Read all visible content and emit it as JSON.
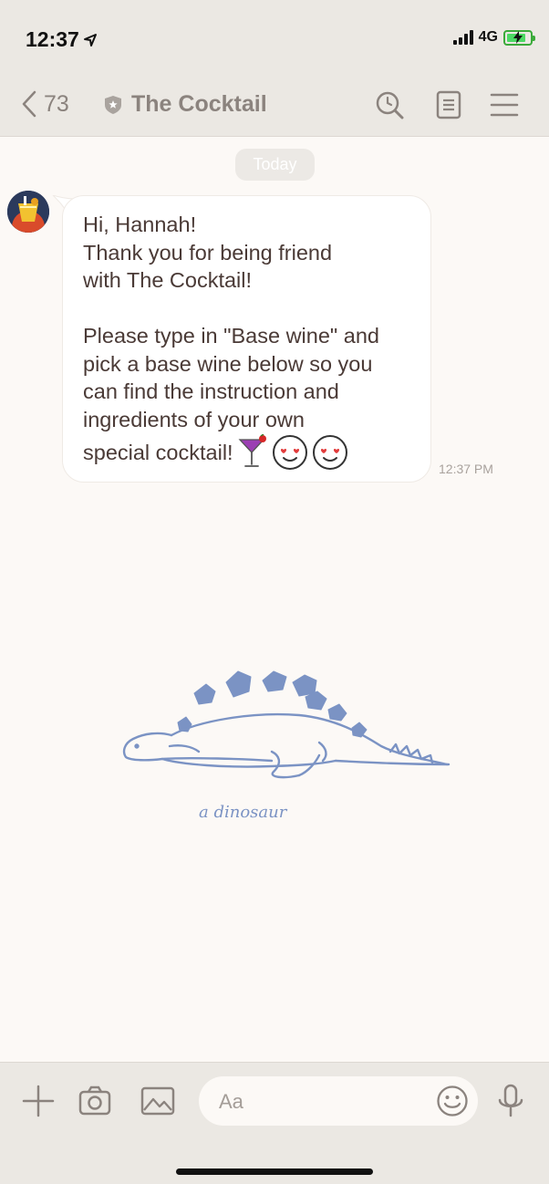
{
  "status_bar": {
    "time": "12:37",
    "network": "4G",
    "battery_charging": true
  },
  "nav": {
    "back_count": "73",
    "title": "The Cocktail",
    "icons": [
      "chevron-left-icon",
      "shield-icon",
      "search-icon",
      "notes-icon",
      "menu-icon"
    ]
  },
  "chat": {
    "date_label": "Today",
    "message": {
      "text": "Hi, Hannah!\nThank you for being friend\nwith The Cocktail!\n\nPlease type in \"Base wine\" and\npick a base wine below so you\ncan find the instruction and\ningredients of your own",
      "last_line": "special cocktail!",
      "emoji": [
        "cocktail-glass-icon",
        "heart-eyes-icon",
        "heart-eyes-icon"
      ],
      "time": "12:37 PM"
    },
    "sticker": {
      "caption": "a dinosaur"
    }
  },
  "composer": {
    "placeholder": "Aa",
    "icons": [
      "plus-icon",
      "camera-icon",
      "image-icon",
      "smile-icon",
      "microphone-icon"
    ]
  },
  "colors": {
    "header_bg": "#ebe8e3",
    "chat_bg": "#fcf9f6",
    "bubble_bg": "#ffffff",
    "dino_blue": "#7b93c4"
  }
}
